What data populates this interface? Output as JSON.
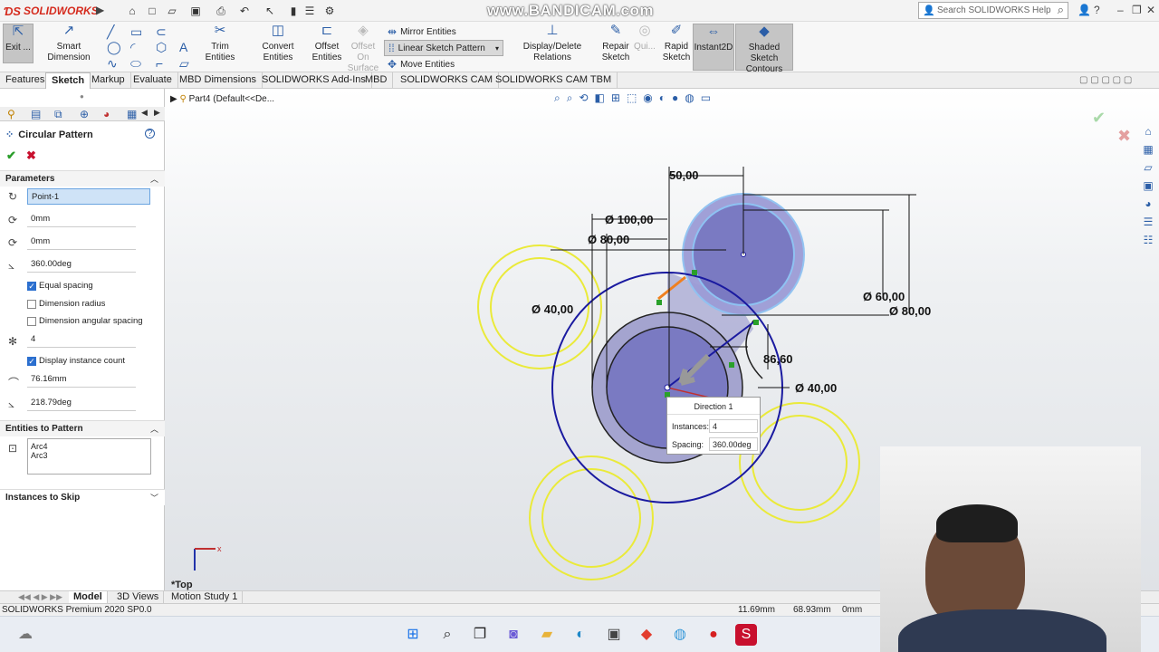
{
  "app": {
    "name": "SOLIDWORKS",
    "version_status": "SOLIDWORKS Premium 2020 SP0.0"
  },
  "watermark": "www.BANDICAM.com",
  "search": {
    "placeholder": "Search SOLIDWORKS Help"
  },
  "ribbon": {
    "exit": "Exit ...",
    "smart_dimension": "Smart Dimension",
    "trim": "Trim Entities",
    "convert": "Convert Entities",
    "offset": "Offset Entities",
    "offset_surface": "Offset On Surface",
    "mirror": "Mirror Entities",
    "linear_pattern": "Linear Sketch Pattern",
    "move": "Move Entities",
    "relations": "Display/Delete Relations",
    "quick": "Qui...",
    "repair": "Repair Sketch",
    "rapid": "Rapid Sketch",
    "instant2d": "Instant2D",
    "shaded": "Shaded Sketch Contours"
  },
  "tabs": [
    "Features",
    "Sketch",
    "Markup",
    "Evaluate",
    "MBD Dimensions",
    "SOLIDWORKS Add-Ins",
    "MBD",
    "SOLIDWORKS CAM",
    "SOLIDWORKS CAM TBM"
  ],
  "selected_tab": "Sketch",
  "breadcrumb": "Part4  (Default<<De...",
  "property_manager": {
    "title": "Circular Pattern",
    "parameters_label": "Parameters",
    "center": "Point-1",
    "x_center": "0mm",
    "y_center": "0mm",
    "angle": "360.00deg",
    "equal_spacing": "Equal spacing",
    "dimension_radius": "Dimension radius",
    "dimension_angular": "Dimension angular spacing",
    "instances": "4",
    "display_count": "Display instance count",
    "radius": "76.16mm",
    "arc_angle": "218.79deg",
    "entities_label": "Entities to Pattern",
    "entities": [
      "Arc4",
      "Arc3"
    ],
    "skip_label": "Instances to Skip"
  },
  "dimensions": {
    "d50": "50,00",
    "d100": "Ø 100,00",
    "d80a": "Ø 80,00",
    "d40a": "Ø 40,00",
    "d60": "Ø 60,00",
    "d80b": "Ø 80,00",
    "d86": "86,60",
    "d40b": "Ø 40,00"
  },
  "direction_popup": {
    "title": "Direction 1",
    "instances_label": "Instances:",
    "instances": "4",
    "spacing_label": "Spacing:",
    "spacing": "360.00deg"
  },
  "view_label": "*Top",
  "bottom_tabs": [
    "Model",
    "3D Views",
    "Motion Study 1"
  ],
  "status": {
    "x": "11.69mm",
    "y": "68.93mm",
    "z": "0mm"
  }
}
